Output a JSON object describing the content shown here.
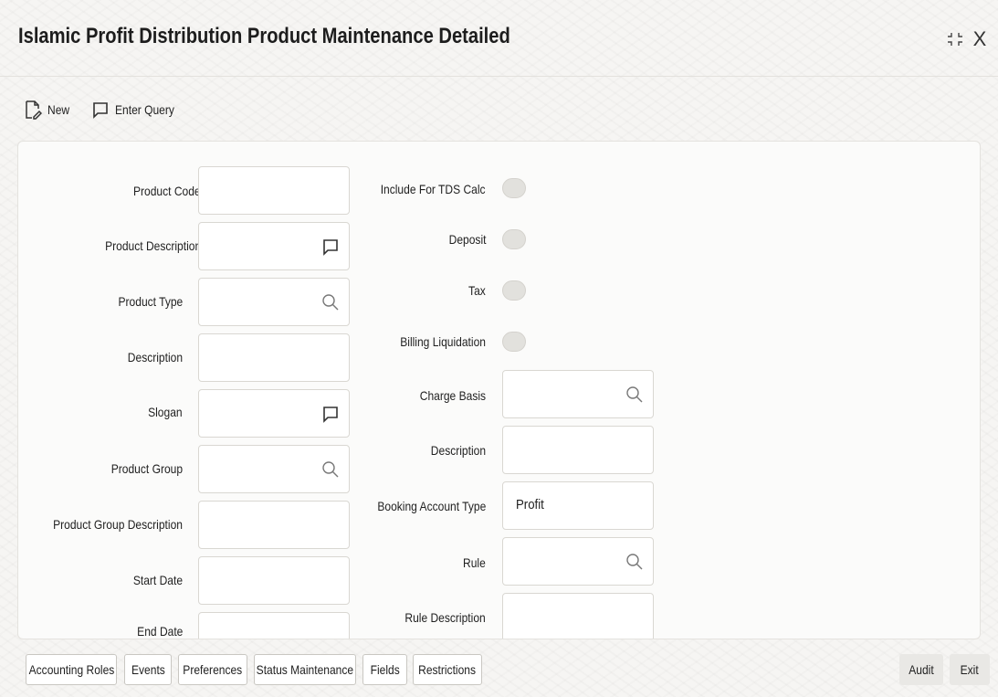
{
  "window": {
    "title": "Islamic Profit Distribution Product Maintenance Detailed",
    "close_glyph": "X"
  },
  "toolbar": {
    "new_label": "New",
    "enter_query_label": "Enter Query"
  },
  "form": {
    "left": [
      {
        "label": "Product Code",
        "required": true,
        "value": "",
        "icon": null
      },
      {
        "label": "Product Description",
        "required": true,
        "value": "",
        "icon": "comment-icon"
      },
      {
        "label": "Product Type",
        "required": false,
        "value": "",
        "icon": "search-icon"
      },
      {
        "label": "Description",
        "required": false,
        "value": "",
        "icon": null
      },
      {
        "label": "Slogan",
        "required": false,
        "value": "",
        "icon": "comment-icon"
      },
      {
        "label": "Product Group",
        "required": false,
        "value": "",
        "icon": "search-icon"
      },
      {
        "label": "Product Group Description",
        "required": false,
        "value": "",
        "icon": null
      },
      {
        "label": "Start Date",
        "required": false,
        "value": "",
        "icon": null
      },
      {
        "label": "End Date",
        "required": false,
        "value": "",
        "icon": null
      }
    ],
    "toggles": [
      {
        "label": "Include For TDS Calc",
        "checked": false
      },
      {
        "label": "Deposit",
        "checked": false
      },
      {
        "label": "Tax",
        "checked": false
      },
      {
        "label": "Billing Liquidation",
        "checked": false
      }
    ],
    "right": [
      {
        "label": "Charge Basis",
        "value": "",
        "icon": "search-icon"
      },
      {
        "label": "Description",
        "value": "",
        "icon": null
      },
      {
        "label": "Booking Account Type",
        "value": "Profit",
        "icon": null
      },
      {
        "label": "Rule",
        "value": "",
        "icon": "search-icon"
      },
      {
        "label": "Rule Description",
        "value": "",
        "icon": null
      }
    ]
  },
  "footer": {
    "tabs": [
      "Accounting Roles",
      "Events",
      "Preferences",
      "Status Maintenance",
      "Fields",
      "Restrictions"
    ],
    "audit_label": "Audit",
    "exit_label": "Exit"
  },
  "colors": {
    "required_marker": "#d0021b",
    "toggle_off": "#e2e1dd"
  }
}
